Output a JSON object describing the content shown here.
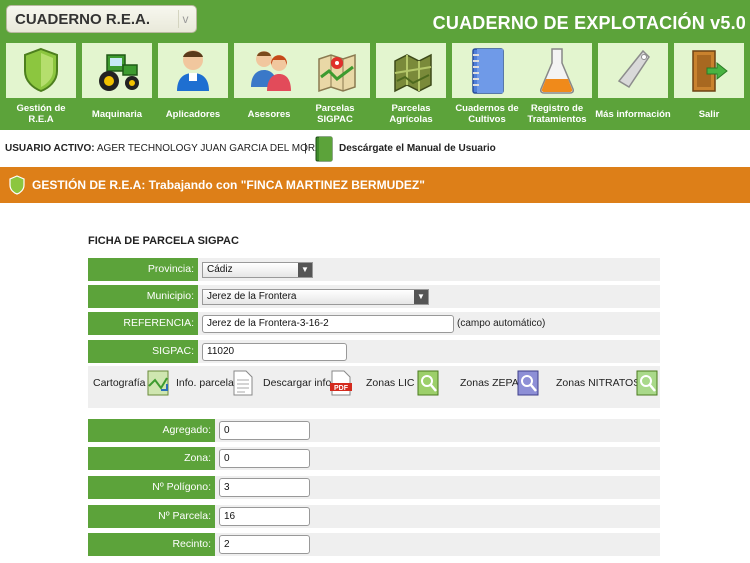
{
  "header": {
    "app_selector": "CUADERNO R.E.A.",
    "app_title": "CUADERNO DE EXPLOTACIÓN v5.0"
  },
  "nav": {
    "items": [
      {
        "label": "Gestión de R.E.A",
        "icon": "shield-icon"
      },
      {
        "label": "Maquinaria",
        "icon": "tractor-icon"
      },
      {
        "label": "Aplicadores",
        "icon": "worker-icon"
      },
      {
        "label": "Asesores",
        "icon": "people-icon"
      },
      {
        "label": "Parcelas SIGPAC",
        "icon": "map-icon"
      },
      {
        "label": "Parcelas Agrícolas",
        "icon": "field-map-icon"
      },
      {
        "label": "Cuadernos de Cultivos",
        "icon": "notebook-icon"
      },
      {
        "label": "Registro de Tratamientos",
        "icon": "flask-icon"
      },
      {
        "label": "Más información",
        "icon": "tag-icon"
      },
      {
        "label": "Salir",
        "icon": "exit-door-icon"
      }
    ]
  },
  "userbar": {
    "label": "USUARIO ACTIVO:",
    "user": "AGER TECHNOLOGY JUAN GARCIA DEL MORAL",
    "separator": "|",
    "manual_link": "Descárgate el Manual de Usuario"
  },
  "section": {
    "title": "GESTIÓN DE R.E.A: Trabajando con \"FINCA MARTINEZ BERMUDEZ\""
  },
  "form": {
    "title": "FICHA DE PARCELA SIGPAC",
    "provincia_label": "Provincia:",
    "provincia_value": "Cádiz",
    "municipio_label": "Municipio:",
    "municipio_value": "Jerez de la Frontera",
    "referencia_label": "REFERENCIA:",
    "referencia_value": "Jerez de la Frontera-3-16-2",
    "referencia_note": "(campo automático)",
    "sigpac_label": "SIGPAC:",
    "sigpac_value": "11020",
    "tools": [
      {
        "label": "Cartografía",
        "icon": "map-icon"
      },
      {
        "label": "Info. parcela",
        "icon": "document-icon"
      },
      {
        "label": "Descargar info.",
        "icon": "pdf-icon"
      },
      {
        "label": "Zonas LIC",
        "icon": "map-zoom-icon"
      },
      {
        "label": "Zonas ZEPA",
        "icon": "map-zoom-icon"
      },
      {
        "label": "Zonas NITRATOS",
        "icon": "map-zoom-icon"
      }
    ],
    "agregado_label": "Agregado:",
    "agregado_value": "0",
    "zona_label": "Zona:",
    "zona_value": "0",
    "poligono_label": "Nº Polígono:",
    "poligono_value": "3",
    "parcela_label": "Nº Parcela:",
    "parcela_value": "16",
    "recinto_label": "Recinto:",
    "recinto_value": "2"
  },
  "colors": {
    "green": "#5ca33a",
    "light_green": "#e3f5cf",
    "orange": "#dd7f18"
  }
}
